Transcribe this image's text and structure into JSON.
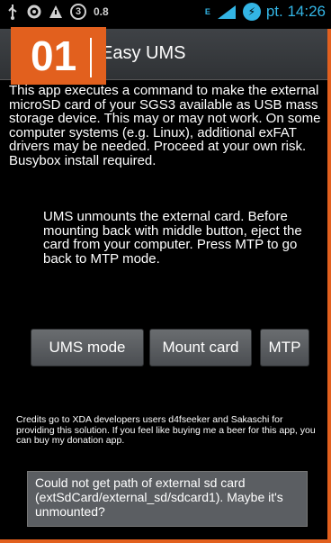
{
  "status_bar": {
    "notification_count": "3",
    "speed": "0.8",
    "network": "E",
    "signal_level": "12",
    "time": "pt. 14:26"
  },
  "action_bar": {
    "title": "Easy UMS"
  },
  "badge": {
    "number": "01"
  },
  "intro_text": "This app executes a command to make the external microSD card of your SGS3 available as USB mass storage device. This may or may not work. On some computer systems (e.g. Linux), additional exFAT drivers may be needed. Proceed at your own risk. Busybox install required.",
  "ums_info_text": "UMS unmounts the external card. Before mounting back with middle button, eject the card from your computer. Press MTP to go back to MTP mode.",
  "buttons": {
    "ums_mode": "UMS mode",
    "mount_card": "Mount card",
    "mtp": "MTP"
  },
  "credits_text": "Credits go to XDA developers users d4fseeker and Sakaschi for providing this solution. If you feel like buying me a beer for this app, you can buy my donation app.",
  "toast": {
    "message": "Could not get path of external sd card (extSdCard/external_sd/sdcard1). Maybe it's unmounted?"
  },
  "colors": {
    "accent_orange": "#e2601e",
    "status_blue": "#33b5e5",
    "button_gray": "#5a5d61"
  }
}
